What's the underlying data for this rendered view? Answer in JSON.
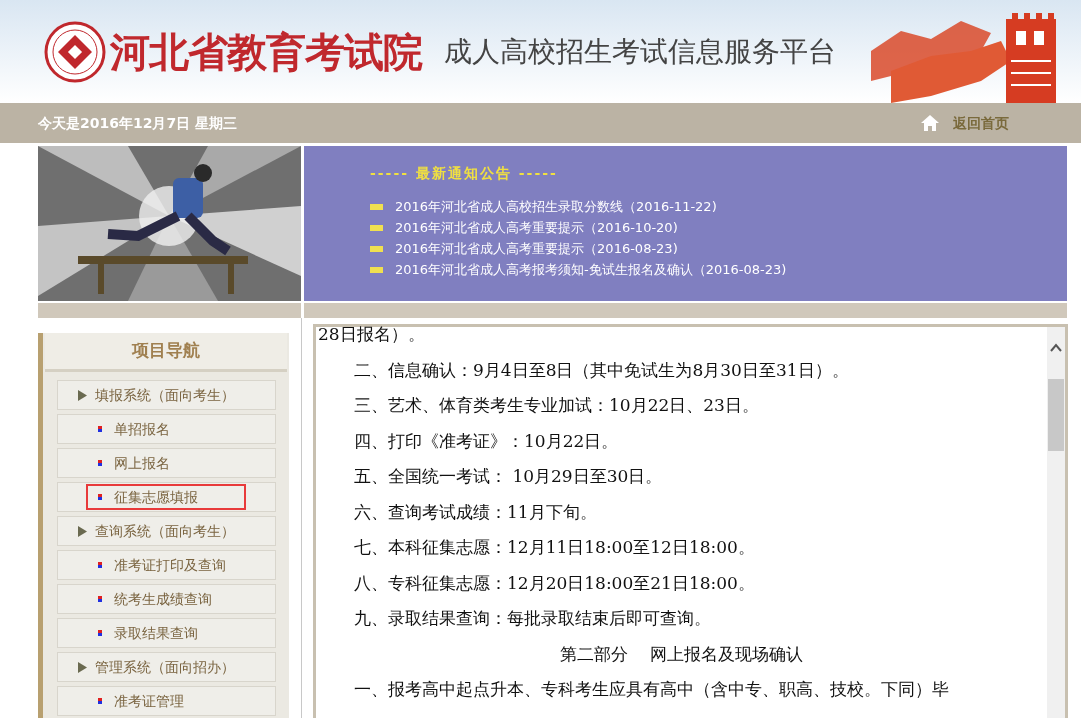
{
  "header": {
    "org_name": "河北省教育考试院",
    "platform_title": "成人高校招生考试信息服务平台"
  },
  "top_bar": {
    "date": "今天是2016年12月7日 星期三",
    "home_link": "返回首页"
  },
  "notices": {
    "title": "----- 最新通知公告 -----",
    "items": [
      {
        "text": "2016年河北省成人高校招生录取分数线（2016-11-22)"
      },
      {
        "text": "2016年河北省成人高考重要提示（2016-10-20)"
      },
      {
        "text": "2016年河北省成人高考重要提示（2016-08-23)"
      },
      {
        "text": "2016年河北省成人高考报考须知-免试生报名及确认（2016-08-23)"
      }
    ]
  },
  "sidebar": {
    "title": "项目导航",
    "items": [
      {
        "label": "填报系统（面向考生）",
        "children": [
          {
            "label": "单招报名",
            "highlighted": false
          },
          {
            "label": "网上报名",
            "highlighted": false
          },
          {
            "label": "征集志愿填报",
            "highlighted": true
          }
        ]
      },
      {
        "label": "查询系统（面向考生）",
        "children": [
          {
            "label": "准考证打印及查询",
            "highlighted": false
          },
          {
            "label": "统考生成绩查询",
            "highlighted": false
          },
          {
            "label": "录取结果查询",
            "highlighted": false
          }
        ]
      },
      {
        "label": "管理系统（面向招办）",
        "children": [
          {
            "label": "准考证管理",
            "highlighted": false
          }
        ]
      }
    ]
  },
  "content": {
    "lines": [
      {
        "kind": "plain",
        "text": "28日报名）。"
      },
      {
        "kind": "indent",
        "text": "二、信息确认：9月4日至8日（其中免试生为8月30日至31日）。"
      },
      {
        "kind": "indent",
        "text": "三、艺术、体育类考生专业加试：10月22日、23日。"
      },
      {
        "kind": "indent",
        "text": "四、打印《准考证》：10月22日。"
      },
      {
        "kind": "indent",
        "text": "五、全国统一考试： 10月29日至30日。"
      },
      {
        "kind": "indent",
        "text": "六、查询考试成绩：11月下旬。"
      },
      {
        "kind": "indent",
        "text": "七、本科征集志愿：12月11日18:00至12日18:00。"
      },
      {
        "kind": "indent",
        "text": "八、专科征集志愿：12月20日18:00至21日18:00。"
      },
      {
        "kind": "indent",
        "text": "九、录取结果查询：每批录取结束后即可查询。"
      },
      {
        "kind": "heading",
        "text": "第二部分　 网上报名及现场确认"
      },
      {
        "kind": "indent",
        "text": "一、报考高中起点升本、专科考生应具有高中（含中专、职高、技校。下同）毕"
      }
    ]
  }
}
